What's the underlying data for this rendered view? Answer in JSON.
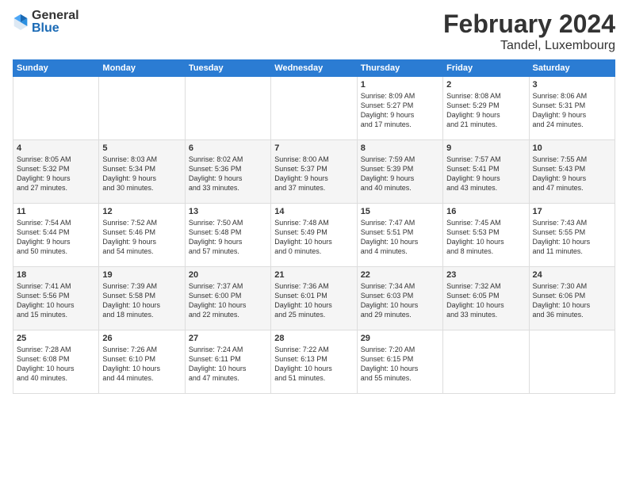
{
  "logo": {
    "general": "General",
    "blue": "Blue"
  },
  "title": "February 2024",
  "subtitle": "Tandel, Luxembourg",
  "days_header": [
    "Sunday",
    "Monday",
    "Tuesday",
    "Wednesday",
    "Thursday",
    "Friday",
    "Saturday"
  ],
  "weeks": [
    [
      {
        "day": "",
        "info": ""
      },
      {
        "day": "",
        "info": ""
      },
      {
        "day": "",
        "info": ""
      },
      {
        "day": "",
        "info": ""
      },
      {
        "day": "1",
        "info": "Sunrise: 8:09 AM\nSunset: 5:27 PM\nDaylight: 9 hours\nand 17 minutes."
      },
      {
        "day": "2",
        "info": "Sunrise: 8:08 AM\nSunset: 5:29 PM\nDaylight: 9 hours\nand 21 minutes."
      },
      {
        "day": "3",
        "info": "Sunrise: 8:06 AM\nSunset: 5:31 PM\nDaylight: 9 hours\nand 24 minutes."
      }
    ],
    [
      {
        "day": "4",
        "info": "Sunrise: 8:05 AM\nSunset: 5:32 PM\nDaylight: 9 hours\nand 27 minutes."
      },
      {
        "day": "5",
        "info": "Sunrise: 8:03 AM\nSunset: 5:34 PM\nDaylight: 9 hours\nand 30 minutes."
      },
      {
        "day": "6",
        "info": "Sunrise: 8:02 AM\nSunset: 5:36 PM\nDaylight: 9 hours\nand 33 minutes."
      },
      {
        "day": "7",
        "info": "Sunrise: 8:00 AM\nSunset: 5:37 PM\nDaylight: 9 hours\nand 37 minutes."
      },
      {
        "day": "8",
        "info": "Sunrise: 7:59 AM\nSunset: 5:39 PM\nDaylight: 9 hours\nand 40 minutes."
      },
      {
        "day": "9",
        "info": "Sunrise: 7:57 AM\nSunset: 5:41 PM\nDaylight: 9 hours\nand 43 minutes."
      },
      {
        "day": "10",
        "info": "Sunrise: 7:55 AM\nSunset: 5:43 PM\nDaylight: 9 hours\nand 47 minutes."
      }
    ],
    [
      {
        "day": "11",
        "info": "Sunrise: 7:54 AM\nSunset: 5:44 PM\nDaylight: 9 hours\nand 50 minutes."
      },
      {
        "day": "12",
        "info": "Sunrise: 7:52 AM\nSunset: 5:46 PM\nDaylight: 9 hours\nand 54 minutes."
      },
      {
        "day": "13",
        "info": "Sunrise: 7:50 AM\nSunset: 5:48 PM\nDaylight: 9 hours\nand 57 minutes."
      },
      {
        "day": "14",
        "info": "Sunrise: 7:48 AM\nSunset: 5:49 PM\nDaylight: 10 hours\nand 0 minutes."
      },
      {
        "day": "15",
        "info": "Sunrise: 7:47 AM\nSunset: 5:51 PM\nDaylight: 10 hours\nand 4 minutes."
      },
      {
        "day": "16",
        "info": "Sunrise: 7:45 AM\nSunset: 5:53 PM\nDaylight: 10 hours\nand 8 minutes."
      },
      {
        "day": "17",
        "info": "Sunrise: 7:43 AM\nSunset: 5:55 PM\nDaylight: 10 hours\nand 11 minutes."
      }
    ],
    [
      {
        "day": "18",
        "info": "Sunrise: 7:41 AM\nSunset: 5:56 PM\nDaylight: 10 hours\nand 15 minutes."
      },
      {
        "day": "19",
        "info": "Sunrise: 7:39 AM\nSunset: 5:58 PM\nDaylight: 10 hours\nand 18 minutes."
      },
      {
        "day": "20",
        "info": "Sunrise: 7:37 AM\nSunset: 6:00 PM\nDaylight: 10 hours\nand 22 minutes."
      },
      {
        "day": "21",
        "info": "Sunrise: 7:36 AM\nSunset: 6:01 PM\nDaylight: 10 hours\nand 25 minutes."
      },
      {
        "day": "22",
        "info": "Sunrise: 7:34 AM\nSunset: 6:03 PM\nDaylight: 10 hours\nand 29 minutes."
      },
      {
        "day": "23",
        "info": "Sunrise: 7:32 AM\nSunset: 6:05 PM\nDaylight: 10 hours\nand 33 minutes."
      },
      {
        "day": "24",
        "info": "Sunrise: 7:30 AM\nSunset: 6:06 PM\nDaylight: 10 hours\nand 36 minutes."
      }
    ],
    [
      {
        "day": "25",
        "info": "Sunrise: 7:28 AM\nSunset: 6:08 PM\nDaylight: 10 hours\nand 40 minutes."
      },
      {
        "day": "26",
        "info": "Sunrise: 7:26 AM\nSunset: 6:10 PM\nDaylight: 10 hours\nand 44 minutes."
      },
      {
        "day": "27",
        "info": "Sunrise: 7:24 AM\nSunset: 6:11 PM\nDaylight: 10 hours\nand 47 minutes."
      },
      {
        "day": "28",
        "info": "Sunrise: 7:22 AM\nSunset: 6:13 PM\nDaylight: 10 hours\nand 51 minutes."
      },
      {
        "day": "29",
        "info": "Sunrise: 7:20 AM\nSunset: 6:15 PM\nDaylight: 10 hours\nand 55 minutes."
      },
      {
        "day": "",
        "info": ""
      },
      {
        "day": "",
        "info": ""
      }
    ]
  ]
}
